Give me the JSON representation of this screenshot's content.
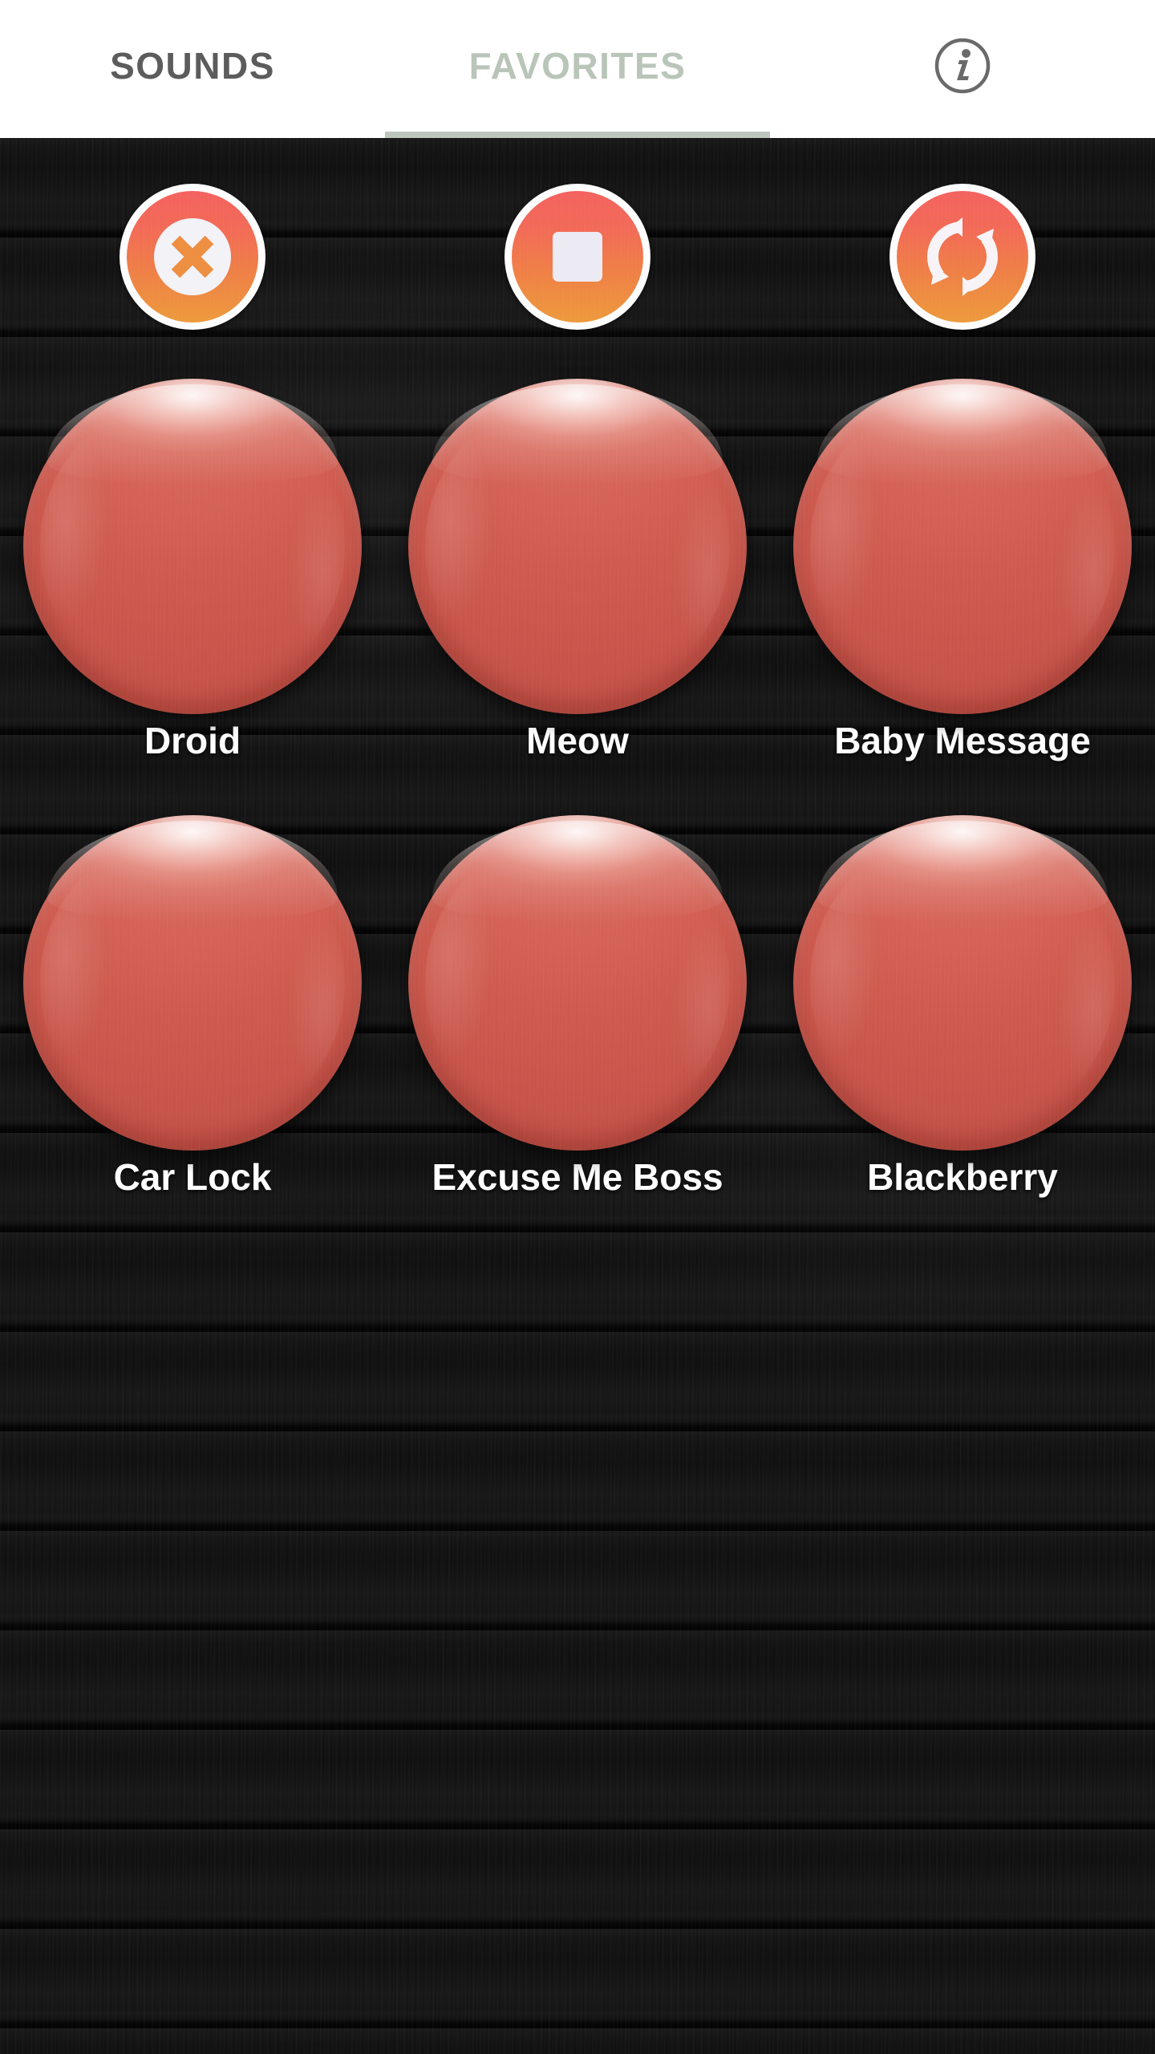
{
  "app": {
    "theme": {
      "header_bg": "#ffffff",
      "active_tab_color": "#b9c5b9",
      "inactive_tab_color": "#5c5c5c",
      "indicator_color": "#bcc6bd",
      "background": "#0d0d0d",
      "pad_color_top": "#d96f61",
      "pad_color_bottom": "#c6544a",
      "control_gradient_top": "#f4625f",
      "control_gradient_bottom": "#ed9a3c",
      "label_color": "#ffffff"
    }
  },
  "header": {
    "tabs": [
      {
        "label": "SOUNDS",
        "active": false,
        "icon": ""
      },
      {
        "label": "FAVORITES",
        "active": true,
        "icon": ""
      }
    ],
    "info_button": {
      "icon": "info-circle-icon",
      "label": ""
    }
  },
  "controls": [
    {
      "name": "clear",
      "icon": "circle-x-icon",
      "label": ""
    },
    {
      "name": "stop",
      "icon": "stop-square-icon",
      "label": ""
    },
    {
      "name": "loop",
      "icon": "loop-repeat-icon",
      "label": ""
    }
  ],
  "grid": {
    "rows": [
      [
        {
          "label": "Droid"
        },
        {
          "label": "Meow"
        },
        {
          "label": "Baby Message"
        }
      ],
      [
        {
          "label": "Car Lock"
        },
        {
          "label": "Excuse Me Boss"
        },
        {
          "label": "Blackberry"
        }
      ]
    ]
  }
}
